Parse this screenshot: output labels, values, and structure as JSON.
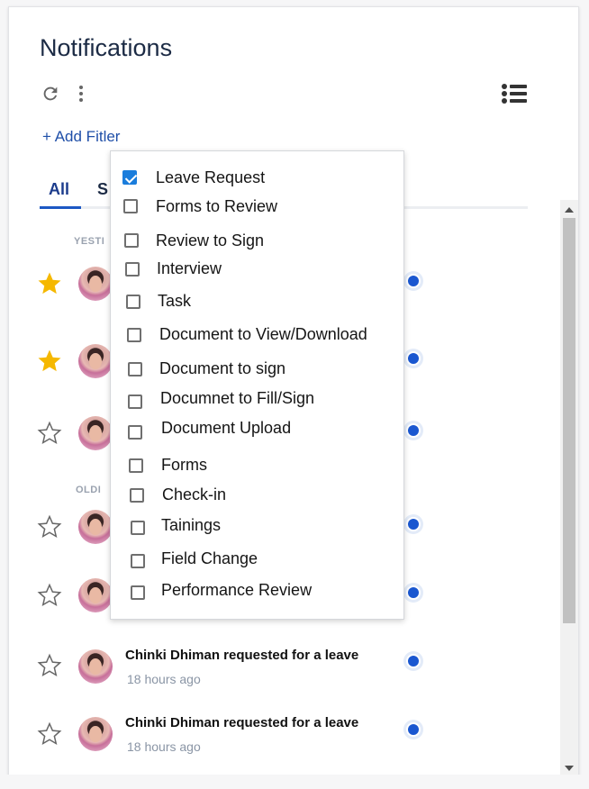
{
  "header": {
    "title": "Notifications",
    "refresh_icon": "refresh-icon",
    "more_icon": "kebab-menu-icon",
    "list_icon": "list-view-icon"
  },
  "filter": {
    "add_label": "+ Add Fitler"
  },
  "tabs": [
    {
      "label": "All",
      "active": true
    },
    {
      "label": "S",
      "active": false
    }
  ],
  "groups": {
    "yesterday": "YESTI",
    "older": "OLDI"
  },
  "notifications": [
    {
      "starred": true,
      "message": "",
      "time": "",
      "unread": true
    },
    {
      "starred": true,
      "message": "",
      "time": "",
      "unread": true
    },
    {
      "starred": false,
      "message": "",
      "time": "",
      "unread": true
    },
    {
      "starred": false,
      "message": "",
      "time": "",
      "unread": true
    },
    {
      "starred": false,
      "message": "",
      "time": "",
      "unread": true
    },
    {
      "starred": false,
      "message": "Chinki Dhiman requested for a leave",
      "time": "18 hours ago",
      "unread": true
    },
    {
      "starred": false,
      "message": "Chinki Dhiman requested for a leave",
      "time": "18 hours ago",
      "unread": true
    }
  ],
  "dropdown": {
    "options": [
      {
        "label": "Leave Request",
        "checked": true
      },
      {
        "label": "Forms to Review",
        "checked": false
      },
      {
        "label": "Review to Sign",
        "checked": false
      },
      {
        "label": "Interview",
        "checked": false
      },
      {
        "label": "Task",
        "checked": false
      },
      {
        "label": "Document to View/Download",
        "checked": false
      },
      {
        "label": "Document to sign",
        "checked": false
      },
      {
        "label": "Documnet to Fill/Sign",
        "checked": false
      },
      {
        "label": "Document Upload",
        "checked": false
      },
      {
        "label": "Forms",
        "checked": false
      },
      {
        "label": "Check-in",
        "checked": false
      },
      {
        "label": "Tainings",
        "checked": false
      },
      {
        "label": "Field Change",
        "checked": false
      },
      {
        "label": "Performance Review",
        "checked": false
      }
    ]
  },
  "colors": {
    "accent": "#1a57d0",
    "star_filled": "#f5b800",
    "title": "#1c2b45",
    "checkbox_checked": "#1a7ddc"
  }
}
